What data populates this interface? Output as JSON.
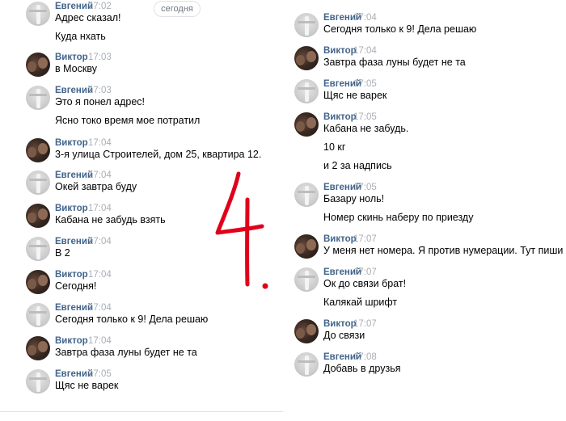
{
  "date_divider": "сегодня",
  "left_messages": [
    {
      "author": "Евгений",
      "time": "17:02",
      "lines": [
        "Адрес сказал!",
        "Куда нхать"
      ]
    },
    {
      "author": "Виктор",
      "time": "17:03",
      "lines": [
        "в Москву"
      ]
    },
    {
      "author": "Евгений",
      "time": "17:03",
      "lines": [
        "Это я понел адрес!",
        "Ясно токо время мое потратил"
      ]
    },
    {
      "author": "Виктор",
      "time": "17:04",
      "lines": [
        "3-я улица Строителей, дом 25, квартира 12."
      ]
    },
    {
      "author": "Евгений",
      "time": "17:04",
      "lines": [
        "Окей завтра буду"
      ]
    },
    {
      "author": "Виктор",
      "time": "17:04",
      "lines": [
        "Кабана не забудь взять"
      ]
    },
    {
      "author": "Евгений",
      "time": "17:04",
      "lines": [
        "В 2"
      ]
    },
    {
      "author": "Виктор",
      "time": "17:04",
      "lines": [
        "Сегодня!"
      ]
    },
    {
      "author": "Евгений",
      "time": "17:04",
      "lines": [
        "Сегодня только к 9! Дела решаю"
      ]
    },
    {
      "author": "Виктор",
      "time": "17:04",
      "lines": [
        "Завтра фаза луны будет не та"
      ]
    },
    {
      "author": "Евгений",
      "time": "17:05",
      "lines": [
        "Щяс не варек"
      ]
    }
  ],
  "right_messages": [
    {
      "author": "Евгений",
      "time": "17:04",
      "lines": [
        "Сегодня только к 9! Дела решаю"
      ]
    },
    {
      "author": "Виктор",
      "time": "17:04",
      "lines": [
        "Завтра фаза луны будет не та"
      ]
    },
    {
      "author": "Евгений",
      "time": "17:05",
      "lines": [
        "Щяс не варек"
      ]
    },
    {
      "author": "Виктор",
      "time": "17:05",
      "lines": [
        "Кабана не забудь.",
        "10 кг",
        "и 2 за надпись"
      ]
    },
    {
      "author": "Евгений",
      "time": "17:05",
      "lines": [
        "Базару ноль!",
        "Номер скинь наберу по приезду"
      ]
    },
    {
      "author": "Виктор",
      "time": "17:07",
      "lines": [
        "У меня нет номера. Я против нумерации. Тут пиши"
      ]
    },
    {
      "author": "Евгений",
      "time": "17:07",
      "lines": [
        "Ок до связи брат!",
        "Калякай шрифт"
      ]
    },
    {
      "author": "Виктор",
      "time": "17:07",
      "lines": [
        "До связи"
      ]
    },
    {
      "author": "Евгений",
      "time": "17:08",
      "lines": [
        "Добавь в друзья"
      ]
    }
  ],
  "colors": {
    "author": "#42648b",
    "time": "#a8aeb6",
    "text": "#000000",
    "annotation": "#e0001a"
  },
  "annotation": "4."
}
